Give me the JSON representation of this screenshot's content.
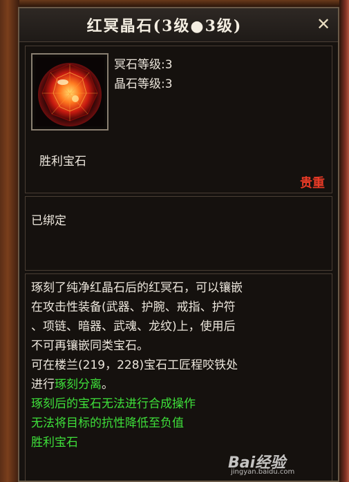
{
  "tooltip": {
    "title": "红冥晶石(3级●3级)",
    "close_icon": "close-icon"
  },
  "item": {
    "stats": [
      "冥石等级:3",
      "晶石等级:3"
    ],
    "name": "胜利宝石",
    "rarity": "贵重",
    "rarity_color": "#e83a26",
    "icon": "red-gem-icon"
  },
  "binding": {
    "status": "已绑定"
  },
  "description": {
    "lines": [
      "琢刻了纯净红晶石后的红冥石，可以镶嵌",
      "在攻击性装备(武器、护腕、戒指、护符",
      "、项链、暗器、武魂、龙纹)上，使用后",
      "不可再镶嵌同类宝石。",
      "可在楼兰(219，228)宝石工匠程咬铁处"
    ],
    "line6_prefix": "进行",
    "line6_highlight": "琢刻分离",
    "line6_suffix": "。",
    "green_lines": [
      "琢刻后的宝石无法进行合成操作",
      "无法将目标的抗性降低至负值",
      "胜利宝石"
    ],
    "highlight_color": "#3ee03a"
  },
  "watermark": {
    "logo": "Bai经验",
    "site": "jingyan.baidu.com"
  }
}
